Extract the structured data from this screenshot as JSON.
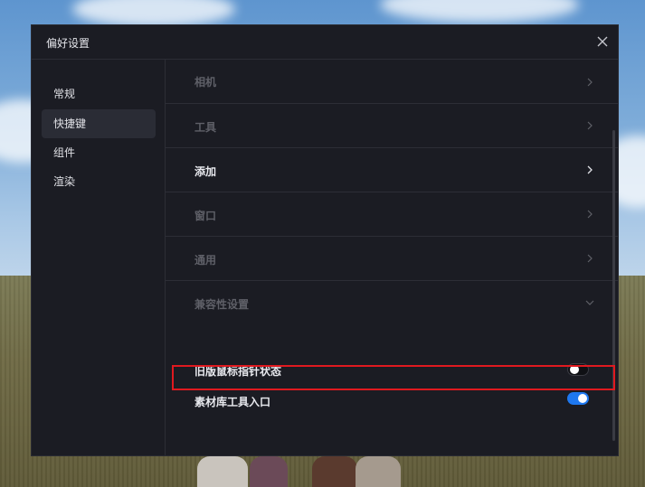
{
  "dialog": {
    "title": "偏好设置",
    "close_icon": "close-icon"
  },
  "sidebar": {
    "items": [
      {
        "label": "常规",
        "active": false
      },
      {
        "label": "快捷键",
        "active": true
      },
      {
        "label": "组件",
        "active": false
      },
      {
        "label": "渲染",
        "active": false
      }
    ]
  },
  "content": {
    "sections": [
      {
        "label": "相机",
        "state": "collapsed",
        "icon": "chevron-right-icon"
      },
      {
        "label": "工具",
        "state": "collapsed",
        "icon": "chevron-right-icon"
      },
      {
        "label": "添加",
        "state": "collapsed",
        "icon": "chevron-right-icon"
      },
      {
        "label": "窗口",
        "state": "collapsed",
        "icon": "chevron-right-icon"
      },
      {
        "label": "通用",
        "state": "collapsed",
        "icon": "chevron-right-icon"
      },
      {
        "label": "兼容性设置",
        "state": "expanded",
        "icon": "chevron-down-icon"
      }
    ],
    "toggles": [
      {
        "label": "旧版鼠标指针状态",
        "enabled": false
      },
      {
        "label": "素材库工具入口",
        "enabled": true
      }
    ]
  },
  "colors": {
    "dialog_bg": "#1b1c23",
    "toggle_on": "#1e78f0",
    "highlight": "#e0191f"
  }
}
